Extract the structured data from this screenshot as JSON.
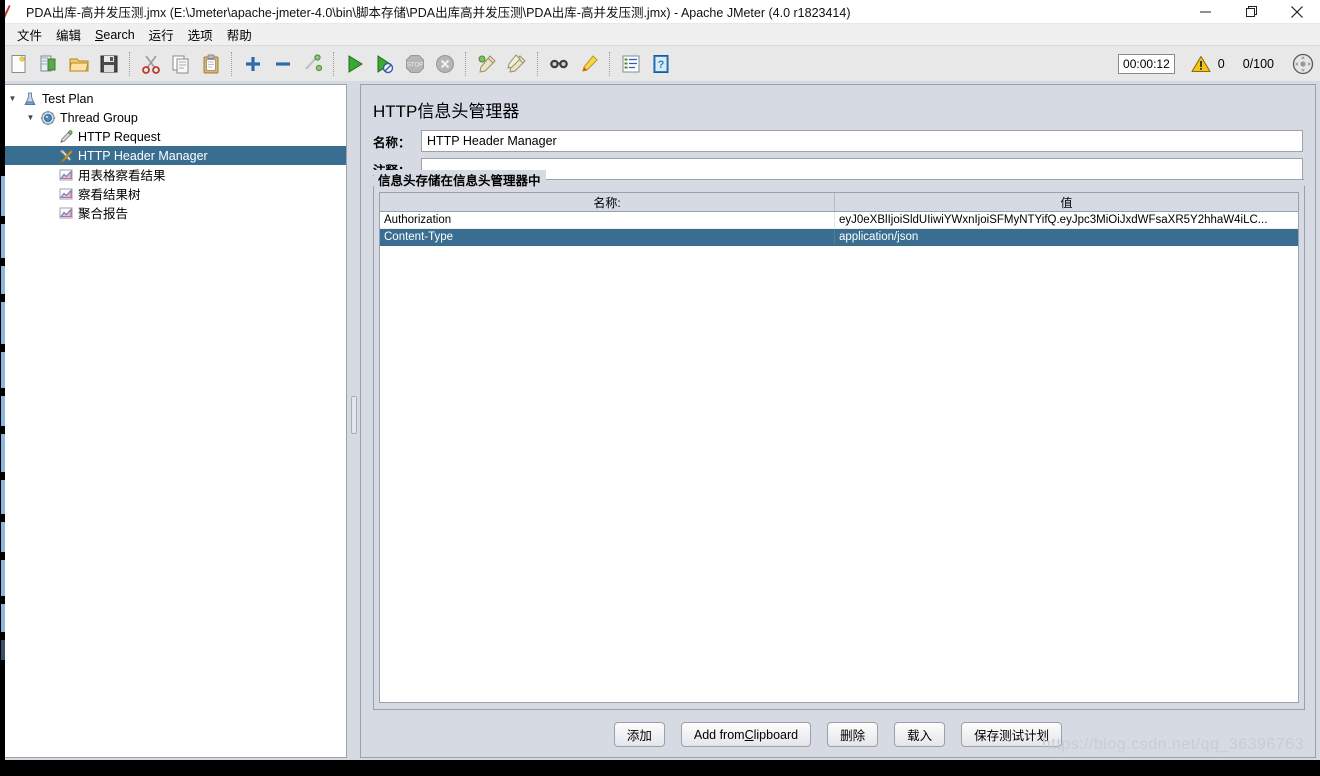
{
  "window": {
    "title": "PDA出库-高并发压测.jmx (E:\\Jmeter\\apache-jmeter-4.0\\bin\\脚本存储\\PDA出库高并发压测\\PDA出库-高并发压测.jmx) - Apache JMeter (4.0 r1823414)",
    "app_icon": "jmeter-feather-icon",
    "minimize": "–",
    "maximize": "❐",
    "close": "✕"
  },
  "menubar": {
    "items": [
      {
        "label": "文件",
        "mnemonic": ""
      },
      {
        "label": "编辑",
        "mnemonic": ""
      },
      {
        "label": "Search",
        "mnemonic": "S"
      },
      {
        "label": "运行",
        "mnemonic": ""
      },
      {
        "label": "选项",
        "mnemonic": ""
      },
      {
        "label": "帮助",
        "mnemonic": ""
      }
    ]
  },
  "toolbar": {
    "buttons": [
      {
        "name": "new-icon"
      },
      {
        "name": "templates-icon"
      },
      {
        "name": "open-icon"
      },
      {
        "name": "save-icon"
      },
      {
        "name": "cut-icon"
      },
      {
        "name": "copy-icon"
      },
      {
        "name": "paste-icon"
      },
      {
        "name": "expand-all-icon"
      },
      {
        "name": "collapse-all-icon"
      },
      {
        "name": "toggle-icon"
      },
      {
        "name": "start-icon"
      },
      {
        "name": "start-no-pauses-icon"
      },
      {
        "name": "stop-icon"
      },
      {
        "name": "shutdown-icon"
      },
      {
        "name": "clear-icon"
      },
      {
        "name": "clear-all-icon"
      },
      {
        "name": "search-icon"
      },
      {
        "name": "search-reset-icon"
      },
      {
        "name": "function-helper-icon"
      },
      {
        "name": "help-icon"
      }
    ],
    "timer": "00:00:12",
    "warning_count": "0",
    "thread_count": "0/100",
    "status_icon": "remote-status-icon"
  },
  "tree": {
    "nodes": [
      {
        "label": "Test Plan",
        "indent": 1,
        "toggle": "▼",
        "icon": "test-plan-icon",
        "selected": false
      },
      {
        "label": "Thread Group",
        "indent": 2,
        "toggle": "▼",
        "icon": "thread-group-icon",
        "selected": false
      },
      {
        "label": "HTTP Request",
        "indent": 3,
        "toggle": "",
        "icon": "http-request-icon",
        "selected": false
      },
      {
        "label": "HTTP Header Manager",
        "indent": 3,
        "toggle": "",
        "icon": "header-manager-icon",
        "selected": true
      },
      {
        "label": "用表格察看结果",
        "indent": 3,
        "toggle": "",
        "icon": "view-results-table-icon",
        "selected": false
      },
      {
        "label": "察看结果树",
        "indent": 3,
        "toggle": "",
        "icon": "view-results-tree-icon",
        "selected": false
      },
      {
        "label": "聚合报告",
        "indent": 3,
        "toggle": "",
        "icon": "aggregate-report-icon",
        "selected": false
      }
    ]
  },
  "panel": {
    "title": "HTTP信息头管理器",
    "name_label": "名称：",
    "name_value": "HTTP Header Manager",
    "comment_label": "注释：",
    "comment_value": "",
    "group_title": "信息头存储在信息头管理器中",
    "table": {
      "columns": [
        "名称:",
        "值"
      ],
      "rows": [
        {
          "name": "Authorization",
          "value": "eyJ0eXBlIjoiSldUIiwiYWxnIjoiSFMyNTYifQ.eyJpc3MiOiJxdWFsaXR5Y2hhaW4iLC...",
          "selected": false
        },
        {
          "name": "Content-Type",
          "value": "application/json",
          "selected": true
        }
      ]
    },
    "buttons": [
      {
        "label": "添加",
        "mnemonic": "",
        "name": "add-button"
      },
      {
        "label": "Add from Clipboard",
        "mnemonic": "C",
        "name": "add-from-clipboard-button"
      },
      {
        "label": "删除",
        "mnemonic": "",
        "name": "delete-button"
      },
      {
        "label": "载入",
        "mnemonic": "",
        "name": "load-button"
      },
      {
        "label": "保存测试计划",
        "mnemonic": "",
        "name": "save-test-plan-button"
      }
    ]
  },
  "watermark": "https://blog.csdn.net/qq_36396763",
  "colors": {
    "selection": "#3a6e91",
    "panel_bg": "#d6dae3",
    "toolbar_bg": "#e8e8e8"
  }
}
